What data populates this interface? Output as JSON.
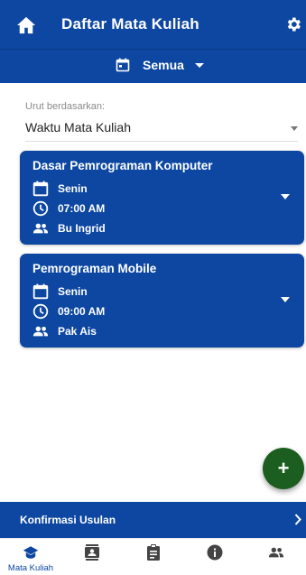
{
  "appbar": {
    "title": "Daftar Mata Kuliah",
    "filter_label": "Semua",
    "icons": [
      "home-icon",
      "gear-icon",
      "calendar-icon",
      "dropdown-caret-icon"
    ]
  },
  "sort": {
    "label": "Urut berdasarkan:",
    "value": "Waktu Mata Kuliah"
  },
  "courses": [
    {
      "name": "Dasar Pemrograman Komputer",
      "day": "Senin",
      "time": "07:00 AM",
      "lecturer": "Bu Ingrid"
    },
    {
      "name": "Pemrograman Mobile",
      "day": "Senin",
      "time": "09:00 AM",
      "lecturer": "Pak Ais"
    }
  ],
  "fab": {
    "symbol": "+"
  },
  "confirm_bar": {
    "label": "Konfirmasi Usulan"
  },
  "bottom_nav": {
    "active_label": "Mata Kuliah",
    "items": [
      "mata-kuliah",
      "contacts",
      "assignment",
      "info",
      "people"
    ]
  },
  "colors": {
    "primary": "#0d47a1",
    "fab": "#1b5e20",
    "background": "#ffffff"
  }
}
